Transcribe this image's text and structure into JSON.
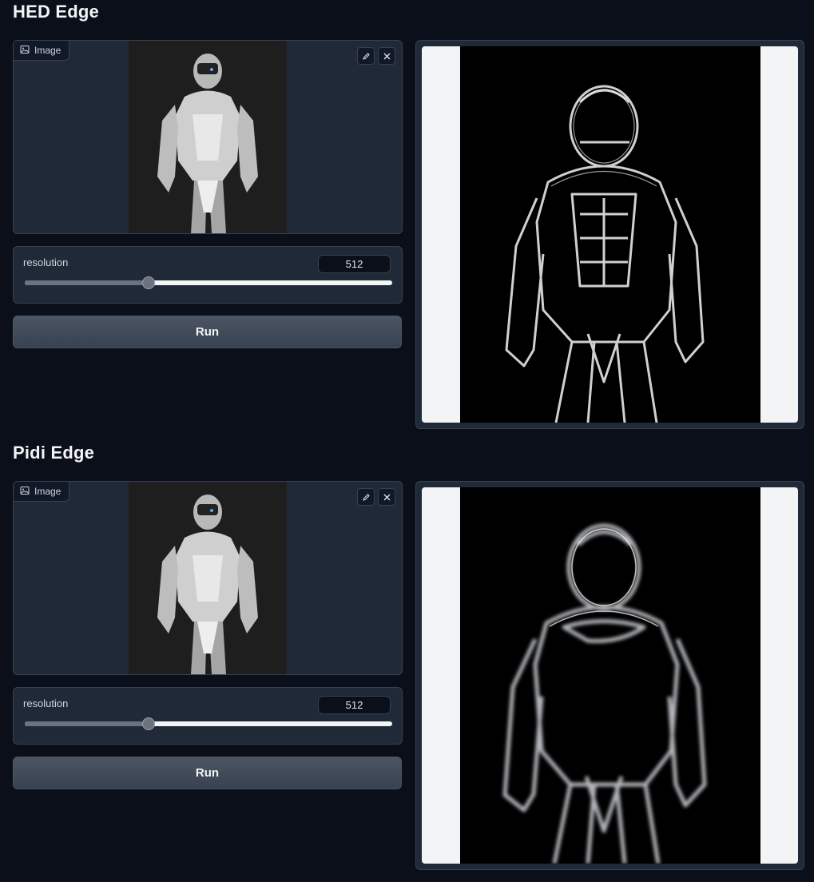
{
  "sections": [
    {
      "title": "HED Edge",
      "image_label": "Image",
      "slider": {
        "label": "resolution",
        "value": "512",
        "fraction": 0.338
      },
      "run_label": "Run"
    },
    {
      "title": "Pidi Edge",
      "image_label": "Image",
      "slider": {
        "label": "resolution",
        "value": "512",
        "fraction": 0.338
      },
      "run_label": "Run"
    }
  ],
  "icons": [
    "image-icon",
    "pencil-icon",
    "close-icon"
  ],
  "colors": {
    "background": "#0b0f19",
    "panel": "#1f2937",
    "border": "#374151"
  }
}
